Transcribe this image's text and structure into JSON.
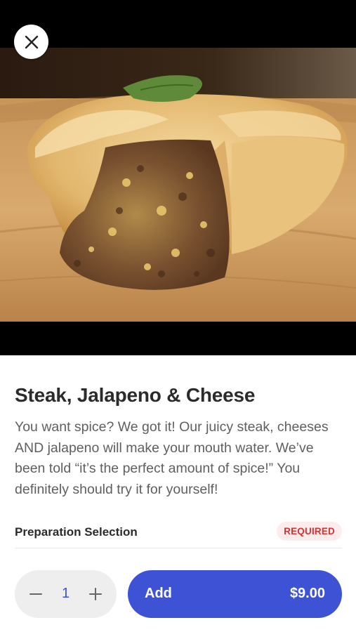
{
  "hero": {
    "image_alt": "steak-pie-photo"
  },
  "header": {
    "close_icon": "close-icon"
  },
  "item": {
    "title": "Steak, Jalapeno & Cheese",
    "description": "You want spice? We got it! Our juicy steak, cheeses AND jalapeno will make your mouth water. We’ve been told “it’s the perfect amount of spice!” You definitely should try it for yourself!"
  },
  "preparation": {
    "label": "Preparation Selection",
    "badge": "REQUIRED"
  },
  "footer": {
    "quantity": "1",
    "minus_icon": "minus-icon",
    "plus_icon": "plus-icon",
    "add_label": "Add",
    "price": "$9.00"
  },
  "colors": {
    "accent": "#3d52d5",
    "required_text": "#d23535",
    "required_bg": "#fdecec",
    "stepper_bg": "#eeeeee"
  }
}
